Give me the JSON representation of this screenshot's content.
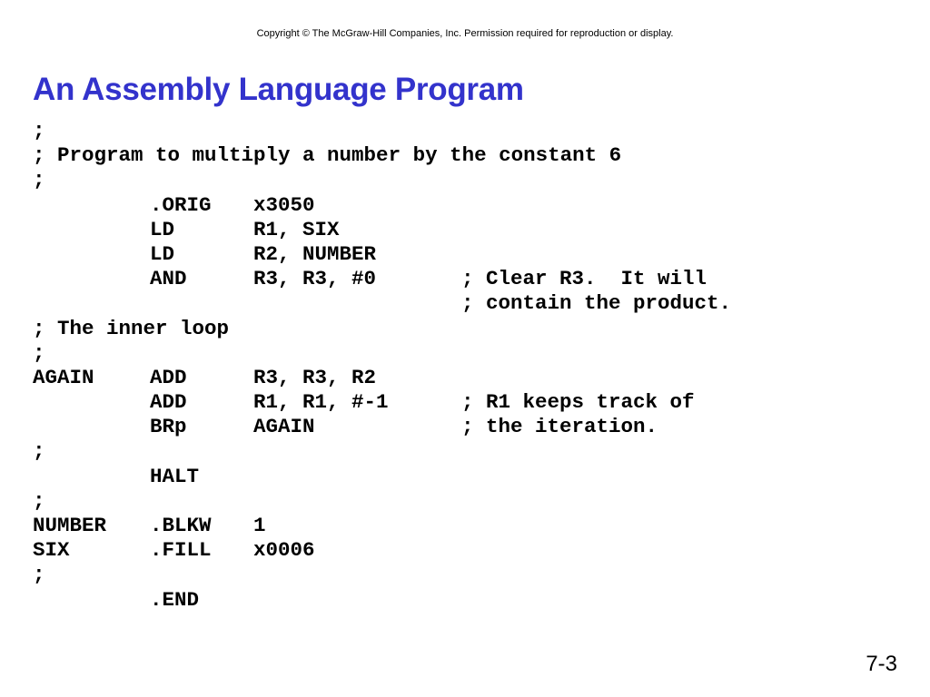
{
  "header": {
    "copyright": "Copyright © The McGraw-Hill Companies, Inc.  Permission required for reproduction or display."
  },
  "slide": {
    "title": "An Assembly Language Program",
    "number": "7-3"
  },
  "program": {
    "lines": [
      {
        "full": ";"
      },
      {
        "full": "; Program to multiply a number by the constant 6"
      },
      {
        "full": ";"
      },
      {
        "label": "",
        "op": ".ORIG",
        "operands": "x3050",
        "comment": ""
      },
      {
        "label": "",
        "op": "LD",
        "operands": "R1, SIX",
        "comment": ""
      },
      {
        "label": "",
        "op": "LD",
        "operands": "R2, NUMBER",
        "comment": ""
      },
      {
        "label": "",
        "op": "AND",
        "operands": "R3, R3, #0",
        "comment": "; Clear R3.  It will"
      },
      {
        "label": "",
        "op": "",
        "operands": "",
        "comment": "; contain the product."
      },
      {
        "full": "; The inner loop"
      },
      {
        "full": ";"
      },
      {
        "label": "AGAIN",
        "op": "ADD",
        "operands": "R3, R3, R2",
        "comment": ""
      },
      {
        "label": "",
        "op": "ADD",
        "operands": "R1, R1, #-1",
        "comment": "; R1 keeps track of"
      },
      {
        "label": "",
        "op": "BRp",
        "operands": "AGAIN",
        "comment": "; the iteration."
      },
      {
        "full": ";"
      },
      {
        "label": "",
        "op": "HALT",
        "operands": "",
        "comment": ""
      },
      {
        "full": ";"
      },
      {
        "label": "NUMBER",
        "op": ".BLKW",
        "operands": "1",
        "comment": ""
      },
      {
        "label": "SIX",
        "op": ".FILL",
        "operands": "x0006",
        "comment": ""
      },
      {
        "full": ";"
      },
      {
        "label": "",
        "op": ".END",
        "operands": "",
        "comment": ""
      }
    ]
  },
  "colors": {
    "title": "#3333cc",
    "text": "#000000",
    "background": "#ffffff"
  }
}
